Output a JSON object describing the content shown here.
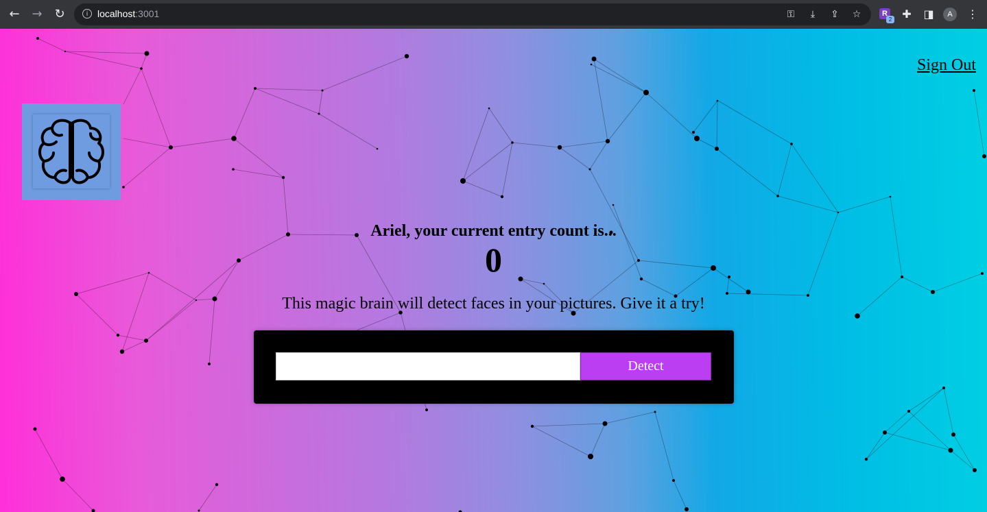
{
  "browser": {
    "url_host": "localhost",
    "url_port": ":3001",
    "extension_letter": "R",
    "extension_count": "2",
    "profile_initial": "A"
  },
  "nav": {
    "signout_label": "Sign Out"
  },
  "rank": {
    "message": "Ariel, your current entry count is...",
    "count": "0"
  },
  "instructions": "This magic brain will detect faces in your pictures. Give it a try!",
  "form": {
    "input_value": "",
    "detect_label": "Detect"
  },
  "icons": {
    "logo": "brain-icon",
    "back": "arrow-left-icon",
    "forward": "arrow-right-icon",
    "reload": "reload-icon"
  },
  "colors": {
    "detect_button": "#bb3ef2",
    "logo_box": "#6f9ce0",
    "gradient_left": "#ff2fd9",
    "gradient_right": "#00cfe3"
  }
}
